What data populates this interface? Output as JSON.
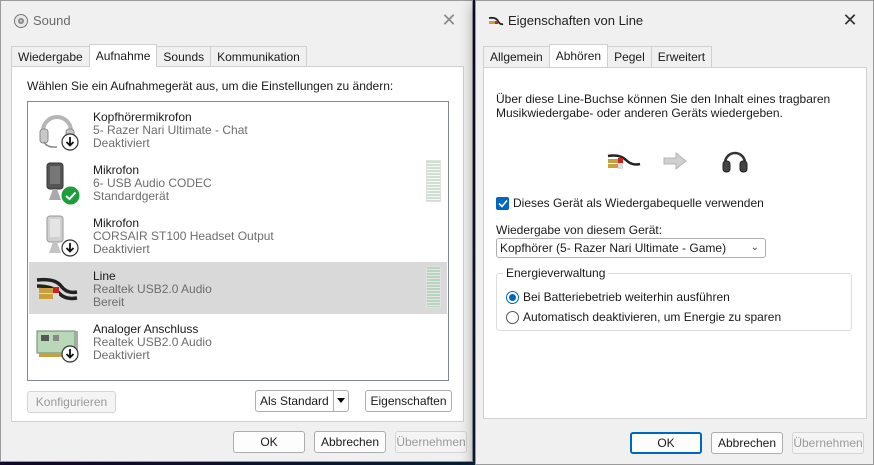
{
  "sound_window": {
    "title": "Sound",
    "tabs": [
      "Wiedergabe",
      "Aufnahme",
      "Sounds",
      "Kommunikation"
    ],
    "active_tab": "Aufnahme",
    "instruction": "Wählen Sie ein Aufnahmegerät aus, um die Einstellungen zu ändern:",
    "devices": [
      {
        "name": "Kopfhörermikrofon",
        "sub": "5- Razer Nari Ultimate - Chat",
        "state": "Deaktiviert",
        "icon": "headset-mic-icon",
        "badge": "down-arrow"
      },
      {
        "name": "Mikrofon",
        "sub": "6- USB Audio CODEC",
        "state": "Standardgerät",
        "icon": "microphone-icon",
        "badge": "check"
      },
      {
        "name": "Mikrofon",
        "sub": "CORSAIR ST100 Headset Output",
        "state": "Deaktiviert",
        "icon": "microphone-icon",
        "badge": "down-arrow"
      },
      {
        "name": "Line",
        "sub": "Realtek USB2.0 Audio",
        "state": "Bereit",
        "icon": "line-cable-icon",
        "badge": "none"
      },
      {
        "name": "Analoger Anschluss",
        "sub": "Realtek USB2.0 Audio",
        "state": "Deaktiviert",
        "icon": "sound-card-icon",
        "badge": "down-arrow"
      }
    ],
    "buttons": {
      "configure": "Konfigurieren",
      "set_default": "Als Standard",
      "properties": "Eigenschaften",
      "ok": "OK",
      "cancel": "Abbrechen",
      "apply": "Übernehmen"
    }
  },
  "props_window": {
    "title": "Eigenschaften von Line",
    "tabs": [
      "Allgemein",
      "Abhören",
      "Pegel",
      "Erweitert"
    ],
    "active_tab": "Abhören",
    "description": "Über diese Line-Buchse können Sie den Inhalt eines tragbaren Musikwiedergabe- oder anderen Geräts wiedergeben.",
    "listen_checkbox": {
      "label": "Dieses Gerät als Wiedergabequelle verwenden",
      "checked": true
    },
    "playback_label": "Wiedergabe von diesem Gerät:",
    "playback_device": "Kopfhörer (5- Razer Nari Ultimate - Game)",
    "power_group": {
      "title": "Energieverwaltung",
      "options": [
        "Bei Batteriebetrieb weiterhin ausführen",
        "Automatisch deaktivieren, um Energie zu sparen"
      ],
      "selected_index": 0
    },
    "buttons": {
      "ok": "OK",
      "cancel": "Abbrechen",
      "apply": "Übernehmen"
    }
  },
  "colors": {
    "accent": "#0067c0",
    "check_green": "#1e9e3a"
  }
}
